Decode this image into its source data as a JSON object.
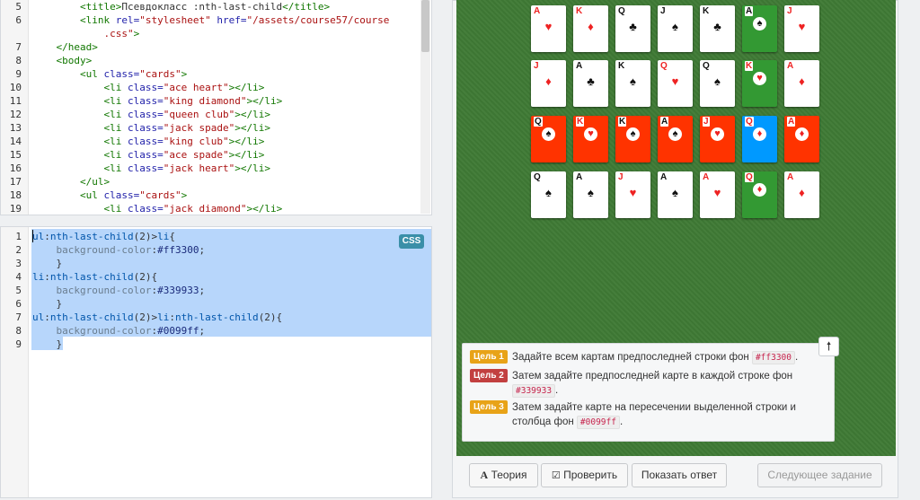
{
  "html_editor": {
    "lines": [
      {
        "n": "5",
        "parts": [
          [
            "",
            "        "
          ],
          [
            "tag",
            "<title>"
          ],
          [
            "",
            "Псевдокласс :nth-last-child"
          ],
          [
            "tag",
            "</title>"
          ]
        ]
      },
      {
        "n": "6",
        "parts": [
          [
            "",
            "        "
          ],
          [
            "tag",
            "<link "
          ],
          [
            "attr",
            "rel="
          ],
          [
            "str",
            "\"stylesheet\""
          ],
          [
            "attr",
            " href="
          ],
          [
            "str",
            "\"/assets/course57/course"
          ]
        ]
      },
      {
        "n": "",
        "parts": [
          [
            "str",
            "            .css\""
          ],
          [
            "tag",
            ">"
          ]
        ]
      },
      {
        "n": "7",
        "parts": [
          [
            "",
            "    "
          ],
          [
            "tag",
            "</head>"
          ]
        ]
      },
      {
        "n": "8",
        "parts": [
          [
            "",
            "    "
          ],
          [
            "tag",
            "<body>"
          ]
        ]
      },
      {
        "n": "9",
        "parts": [
          [
            "",
            "        "
          ],
          [
            "tag",
            "<ul "
          ],
          [
            "attr",
            "class="
          ],
          [
            "str",
            "\"cards\""
          ],
          [
            "tag",
            ">"
          ]
        ]
      },
      {
        "n": "10",
        "parts": [
          [
            "",
            "            "
          ],
          [
            "tag",
            "<li "
          ],
          [
            "attr",
            "class="
          ],
          [
            "str",
            "\"ace heart\""
          ],
          [
            "tag",
            "></li>"
          ]
        ]
      },
      {
        "n": "11",
        "parts": [
          [
            "",
            "            "
          ],
          [
            "tag",
            "<li "
          ],
          [
            "attr",
            "class="
          ],
          [
            "str",
            "\"king diamond\""
          ],
          [
            "tag",
            "></li>"
          ]
        ]
      },
      {
        "n": "12",
        "parts": [
          [
            "",
            "            "
          ],
          [
            "tag",
            "<li "
          ],
          [
            "attr",
            "class="
          ],
          [
            "str",
            "\"queen club\""
          ],
          [
            "tag",
            "></li>"
          ]
        ]
      },
      {
        "n": "13",
        "parts": [
          [
            "",
            "            "
          ],
          [
            "tag",
            "<li "
          ],
          [
            "attr",
            "class="
          ],
          [
            "str",
            "\"jack spade\""
          ],
          [
            "tag",
            "></li>"
          ]
        ]
      },
      {
        "n": "14",
        "parts": [
          [
            "",
            "            "
          ],
          [
            "tag",
            "<li "
          ],
          [
            "attr",
            "class="
          ],
          [
            "str",
            "\"king club\""
          ],
          [
            "tag",
            "></li>"
          ]
        ]
      },
      {
        "n": "15",
        "parts": [
          [
            "",
            "            "
          ],
          [
            "tag",
            "<li "
          ],
          [
            "attr",
            "class="
          ],
          [
            "str",
            "\"ace spade\""
          ],
          [
            "tag",
            "></li>"
          ]
        ]
      },
      {
        "n": "16",
        "parts": [
          [
            "",
            "            "
          ],
          [
            "tag",
            "<li "
          ],
          [
            "attr",
            "class="
          ],
          [
            "str",
            "\"jack heart\""
          ],
          [
            "tag",
            "></li>"
          ]
        ]
      },
      {
        "n": "17",
        "parts": [
          [
            "",
            "        "
          ],
          [
            "tag",
            "</ul>"
          ]
        ]
      },
      {
        "n": "18",
        "parts": [
          [
            "",
            "        "
          ],
          [
            "tag",
            "<ul "
          ],
          [
            "attr",
            "class="
          ],
          [
            "str",
            "\"cards\""
          ],
          [
            "tag",
            ">"
          ]
        ]
      },
      {
        "n": "19",
        "parts": [
          [
            "",
            "            "
          ],
          [
            "tag",
            "<li "
          ],
          [
            "attr",
            "class="
          ],
          [
            "str",
            "\"jack diamond\""
          ],
          [
            "tag",
            "></li>"
          ]
        ]
      }
    ]
  },
  "css_editor": {
    "badge": "CSS",
    "lines": [
      {
        "n": "1",
        "parts": [
          [
            "sel",
            "ul"
          ],
          [
            "pct",
            ":"
          ],
          [
            "sel",
            "nth-last-child"
          ],
          [
            "pct",
            "(2)>"
          ],
          [
            "sel",
            "li"
          ],
          [
            "pct",
            "{"
          ]
        ]
      },
      {
        "n": "2",
        "parts": [
          [
            "",
            "    "
          ],
          [
            "prop",
            "background-color"
          ],
          [
            "pct",
            ":"
          ],
          [
            "val",
            "#ff3300"
          ],
          [
            "pct",
            ";"
          ]
        ]
      },
      {
        "n": "3",
        "parts": [
          [
            "",
            "    "
          ],
          [
            "pct",
            "}"
          ]
        ]
      },
      {
        "n": "4",
        "parts": [
          [
            "sel",
            "li"
          ],
          [
            "pct",
            ":"
          ],
          [
            "sel",
            "nth-last-child"
          ],
          [
            "pct",
            "(2){"
          ]
        ]
      },
      {
        "n": "5",
        "parts": [
          [
            "",
            "    "
          ],
          [
            "prop",
            "background-color"
          ],
          [
            "pct",
            ":"
          ],
          [
            "val",
            "#339933"
          ],
          [
            "pct",
            ";"
          ]
        ]
      },
      {
        "n": "6",
        "parts": [
          [
            "",
            "    "
          ],
          [
            "pct",
            "}"
          ]
        ]
      },
      {
        "n": "7",
        "parts": [
          [
            "sel",
            "ul"
          ],
          [
            "pct",
            ":"
          ],
          [
            "sel",
            "nth-last-child"
          ],
          [
            "pct",
            "(2)>"
          ],
          [
            "sel",
            "li"
          ],
          [
            "pct",
            ":"
          ],
          [
            "sel",
            "nth-last-child"
          ],
          [
            "pct",
            "(2){"
          ]
        ]
      },
      {
        "n": "8",
        "parts": [
          [
            "",
            "    "
          ],
          [
            "prop",
            "background-color"
          ],
          [
            "pct",
            ":"
          ],
          [
            "val",
            "#0099ff"
          ],
          [
            "pct",
            ";"
          ]
        ]
      },
      {
        "n": "9",
        "parts": [
          [
            "",
            "    "
          ],
          [
            "pct",
            "}"
          ]
        ]
      }
    ]
  },
  "cards": [
    [
      {
        "r": "A",
        "s": "♥",
        "c": "red",
        "bg": "white"
      },
      {
        "r": "K",
        "s": "♦",
        "c": "red",
        "bg": "white"
      },
      {
        "r": "Q",
        "s": "♣",
        "c": "blk",
        "bg": "white"
      },
      {
        "r": "J",
        "s": "♠",
        "c": "blk",
        "bg": "white"
      },
      {
        "r": "K",
        "s": "♣",
        "c": "blk",
        "bg": "white"
      },
      {
        "r": "A",
        "s": "♠",
        "c": "blk",
        "bg": "green"
      },
      {
        "r": "J",
        "s": "♥",
        "c": "red",
        "bg": "white"
      }
    ],
    [
      {
        "r": "J",
        "s": "♦",
        "c": "red",
        "bg": "white"
      },
      {
        "r": "A",
        "s": "♣",
        "c": "blk",
        "bg": "white"
      },
      {
        "r": "K",
        "s": "♠",
        "c": "blk",
        "bg": "white"
      },
      {
        "r": "Q",
        "s": "♥",
        "c": "red",
        "bg": "white"
      },
      {
        "r": "Q",
        "s": "♠",
        "c": "blk",
        "bg": "white"
      },
      {
        "r": "K",
        "s": "♥",
        "c": "red",
        "bg": "green"
      },
      {
        "r": "A",
        "s": "♦",
        "c": "red",
        "bg": "white"
      }
    ],
    [
      {
        "r": "Q",
        "s": "♠",
        "c": "blk",
        "bg": "orange"
      },
      {
        "r": "K",
        "s": "♥",
        "c": "red",
        "bg": "orange"
      },
      {
        "r": "K",
        "s": "♠",
        "c": "blk",
        "bg": "orange"
      },
      {
        "r": "A",
        "s": "♠",
        "c": "blk",
        "bg": "orange"
      },
      {
        "r": "J",
        "s": "♥",
        "c": "red",
        "bg": "orange"
      },
      {
        "r": "Q",
        "s": "♦",
        "c": "red",
        "bg": "blue"
      },
      {
        "r": "A",
        "s": "♦",
        "c": "red",
        "bg": "orange"
      }
    ],
    [
      {
        "r": "Q",
        "s": "♠",
        "c": "blk",
        "bg": "white"
      },
      {
        "r": "A",
        "s": "♠",
        "c": "blk",
        "bg": "white"
      },
      {
        "r": "J",
        "s": "♥",
        "c": "red",
        "bg": "white"
      },
      {
        "r": "A",
        "s": "♠",
        "c": "blk",
        "bg": "white"
      },
      {
        "r": "A",
        "s": "♥",
        "c": "red",
        "bg": "white"
      },
      {
        "r": "Q",
        "s": "♦",
        "c": "red",
        "bg": "green"
      },
      {
        "r": "A",
        "s": "♦",
        "c": "red",
        "bg": "white"
      }
    ]
  ],
  "colors": {
    "orange": "#ff3300",
    "green": "#339933",
    "blue": "#0099ff"
  },
  "goals": {
    "toggle_icon": "arrow-up-icon",
    "items": [
      {
        "badge": "Цель 1",
        "badge_color": "yellow",
        "text_before": "Задайте всем картам предпоследней строки фон ",
        "code": "#ff3300",
        "text_after": "."
      },
      {
        "badge": "Цель 2",
        "badge_color": "red",
        "text_before": "Затем задайте предпоследней карте в каждой строке фон ",
        "code": "#339933",
        "text_after": "."
      },
      {
        "badge": "Цель 3",
        "badge_color": "yellow",
        "text_before": "Затем задайте карте на пересечении выделенной строки и столбца фон ",
        "code": "#0099ff",
        "text_after": "."
      }
    ]
  },
  "buttons": {
    "theory": "Теория",
    "check": "Проверить",
    "show_answer": "Показать ответ",
    "next_task": "Следующее задание"
  }
}
